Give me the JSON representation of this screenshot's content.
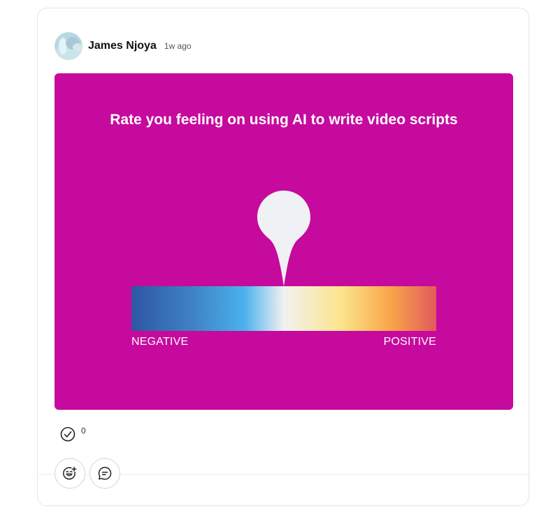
{
  "post": {
    "author": "James Njoya",
    "time": "1w ago"
  },
  "poll": {
    "question": "Rate you feeling on using AI to write video scripts",
    "left_label": "NEGATIVE",
    "right_label": "POSITIVE",
    "background_color": "#c60a9e",
    "marker_position": 0.5
  },
  "reactions": {
    "count": "0",
    "icon": "check-circle-icon"
  },
  "actions": {
    "react_icon": "emoji-add-icon",
    "comment_icon": "comment-icon"
  }
}
